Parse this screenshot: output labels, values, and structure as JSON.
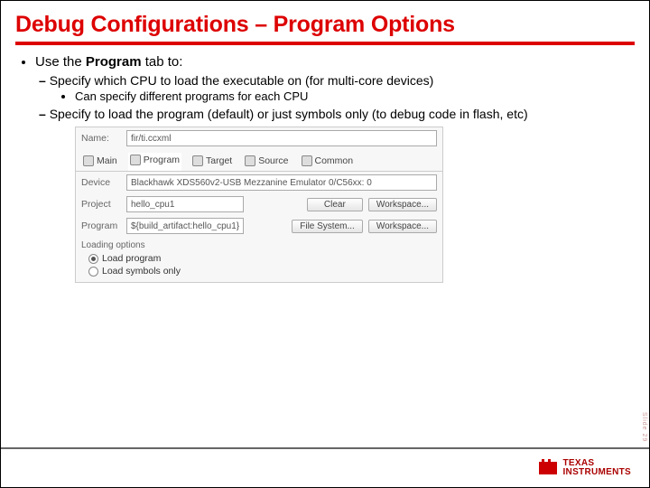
{
  "title": "Debug Configurations – Program Options",
  "bullet_main_pre": "Use the ",
  "bullet_main_strong": "Program",
  "bullet_main_post": " tab to:",
  "sub1_a": "Specify which CPU to load the executable on (for multi-core devices)",
  "sub2_a": "Can specify different programs for each CPU",
  "sub1_b": "Specify to load the program (default) or just symbols only (to debug code in flash, etc)",
  "panel": {
    "name_label": "Name:",
    "name_value": "fir/ti.ccxml",
    "tabs": {
      "main": "Main",
      "program": "Program",
      "target": "Target",
      "source": "Source",
      "common": "Common"
    },
    "device_label": "Device",
    "device_value": "Blackhawk XDS560v2-USB Mezzanine Emulator 0/C56xx: 0",
    "project_label": "Project",
    "project_value": "hello_cpu1",
    "program_label": "Program",
    "program_value": "${build_artifact:hello_cpu1}",
    "btn_clear": "Clear",
    "btn_workspace": "Workspace...",
    "btn_filesystem": "File System...",
    "loading_header": "Loading options",
    "radio_load_program": "Load program",
    "radio_load_symbols": "Load symbols only"
  },
  "logo_line1": "TEXAS",
  "logo_line2": "INSTRUMENTS",
  "side_tag": "Slide 29"
}
